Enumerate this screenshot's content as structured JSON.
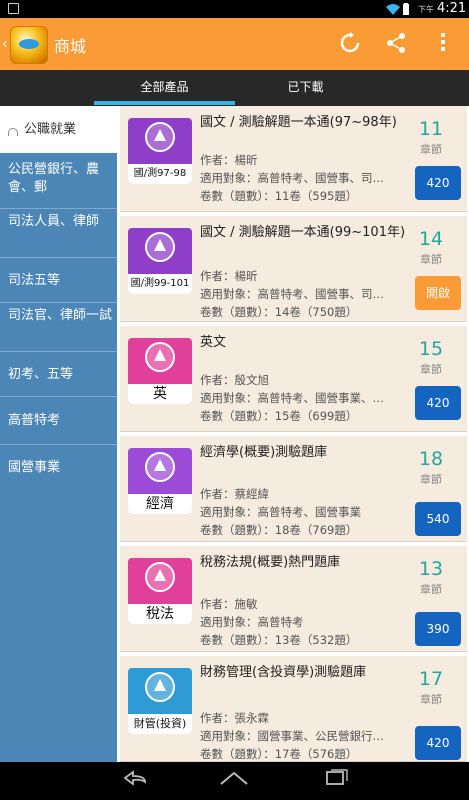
{
  "statusbar": {
    "ampm": "下午",
    "time": "4:21"
  },
  "header": {
    "back_icon": "chevron-left-icon",
    "title": "商城",
    "icons": [
      "refresh-icon",
      "share-icon",
      "overflow-menu-icon"
    ]
  },
  "tabs": [
    {
      "label": "全部產品",
      "selected": true
    },
    {
      "label": "已下載",
      "selected": false
    }
  ],
  "sidebar": {
    "items": [
      {
        "label": "公職就業",
        "active": true
      },
      {
        "label": "公民營銀行、農會、郵"
      },
      {
        "label": "司法人員、律師"
      },
      {
        "label": "司法五等"
      },
      {
        "label": "司法官、律師一試"
      },
      {
        "label": "初考、五等"
      },
      {
        "label": "高普特考"
      },
      {
        "label": "國營事業"
      }
    ]
  },
  "products": [
    {
      "title": "國文 / 測驗解題一本通(97~98年)",
      "author": "作者：楊昕",
      "target": "適用對象：高普特考、國營事、司…",
      "volumes": "卷數（題數）：11卷（595題）",
      "count": "11",
      "unit": "章節",
      "button": "420",
      "button_type": "price",
      "thumb_label": "國/測97-98",
      "thumb_color": "#8e3ec8"
    },
    {
      "title": "國文 / 測驗解題一本通(99~101年)",
      "author": "作者：楊昕",
      "target": "適用對象：高普特考、國營事、司…",
      "volumes": "卷數（題數）：14卷（750題）",
      "count": "14",
      "unit": "章節",
      "button": "開啟",
      "button_type": "open",
      "thumb_label": "國/測99-101",
      "thumb_color": "#8e3ec8"
    },
    {
      "title": "英文",
      "author": "作者：殷文旭",
      "target": "適用對象：高普特考、國營事業、…",
      "volumes": "卷數（題數）：15卷（699題）",
      "count": "15",
      "unit": "章節",
      "button": "420",
      "button_type": "price",
      "thumb_label": "英",
      "thumb_color": "#e0409a"
    },
    {
      "title": "經濟學(概要)測驗題庫",
      "author": "作者：蔡經緯",
      "target": "適用對象：高普特考、國營事業",
      "volumes": "卷數（題數）：18卷（769題）",
      "count": "18",
      "unit": "章節",
      "button": "540",
      "button_type": "price",
      "thumb_label": "經濟",
      "thumb_color": "#9c4ad8"
    },
    {
      "title": "稅務法規(概要)熱門題庫",
      "author": "作者：施敏",
      "target": "適用對象：高普特考",
      "volumes": "卷數（題數）：13卷（532題）",
      "count": "13",
      "unit": "章節",
      "button": "390",
      "button_type": "price",
      "thumb_label": "稅法",
      "thumb_color": "#e0409a"
    },
    {
      "title": "財務管理(含投資學)測驗題庫",
      "author": "作者：張永霖",
      "target": "適用對象：國營事業、公民營銀行…",
      "volumes": "卷數（題數）：17卷（576題）",
      "count": "17",
      "unit": "章節",
      "button": "420",
      "button_type": "price",
      "thumb_label": "財管(投資)",
      "thumb_color": "#2e9ad6"
    }
  ],
  "navbar": {
    "icons": [
      "back-icon",
      "home-icon",
      "recent-apps-icon"
    ]
  }
}
